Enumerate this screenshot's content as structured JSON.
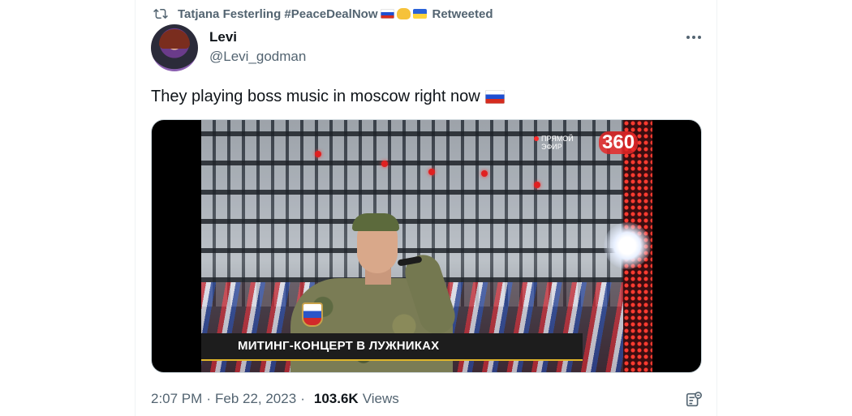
{
  "retweet": {
    "user": "Tatjana Festerling #PeaceDealNow",
    "label": "Retweeted",
    "icon": "retweet-icon",
    "emoji": [
      "flag-russia",
      "handshake",
      "flag-ukraine"
    ]
  },
  "author": {
    "name": "Levi",
    "handle": "@Levi_godman"
  },
  "tweet": {
    "text": "They playing boss music in moscow right now",
    "emoji": "flag-russia"
  },
  "media": {
    "caption": "МИТИНГ-КОНЦЕРТ В ЛУЖНИКАХ",
    "live_label_line1": "ПРЯМОЙ",
    "live_label_line2": "ЭФИР",
    "channel_logo": "360"
  },
  "meta": {
    "time": "2:07 PM",
    "separator": "·",
    "date": "Feb 22, 2023",
    "views_count": "103.6K",
    "views_label": "Views"
  },
  "colors": {
    "text_primary": "#0f1419",
    "text_secondary": "#536471",
    "border": "#eff3f4"
  }
}
